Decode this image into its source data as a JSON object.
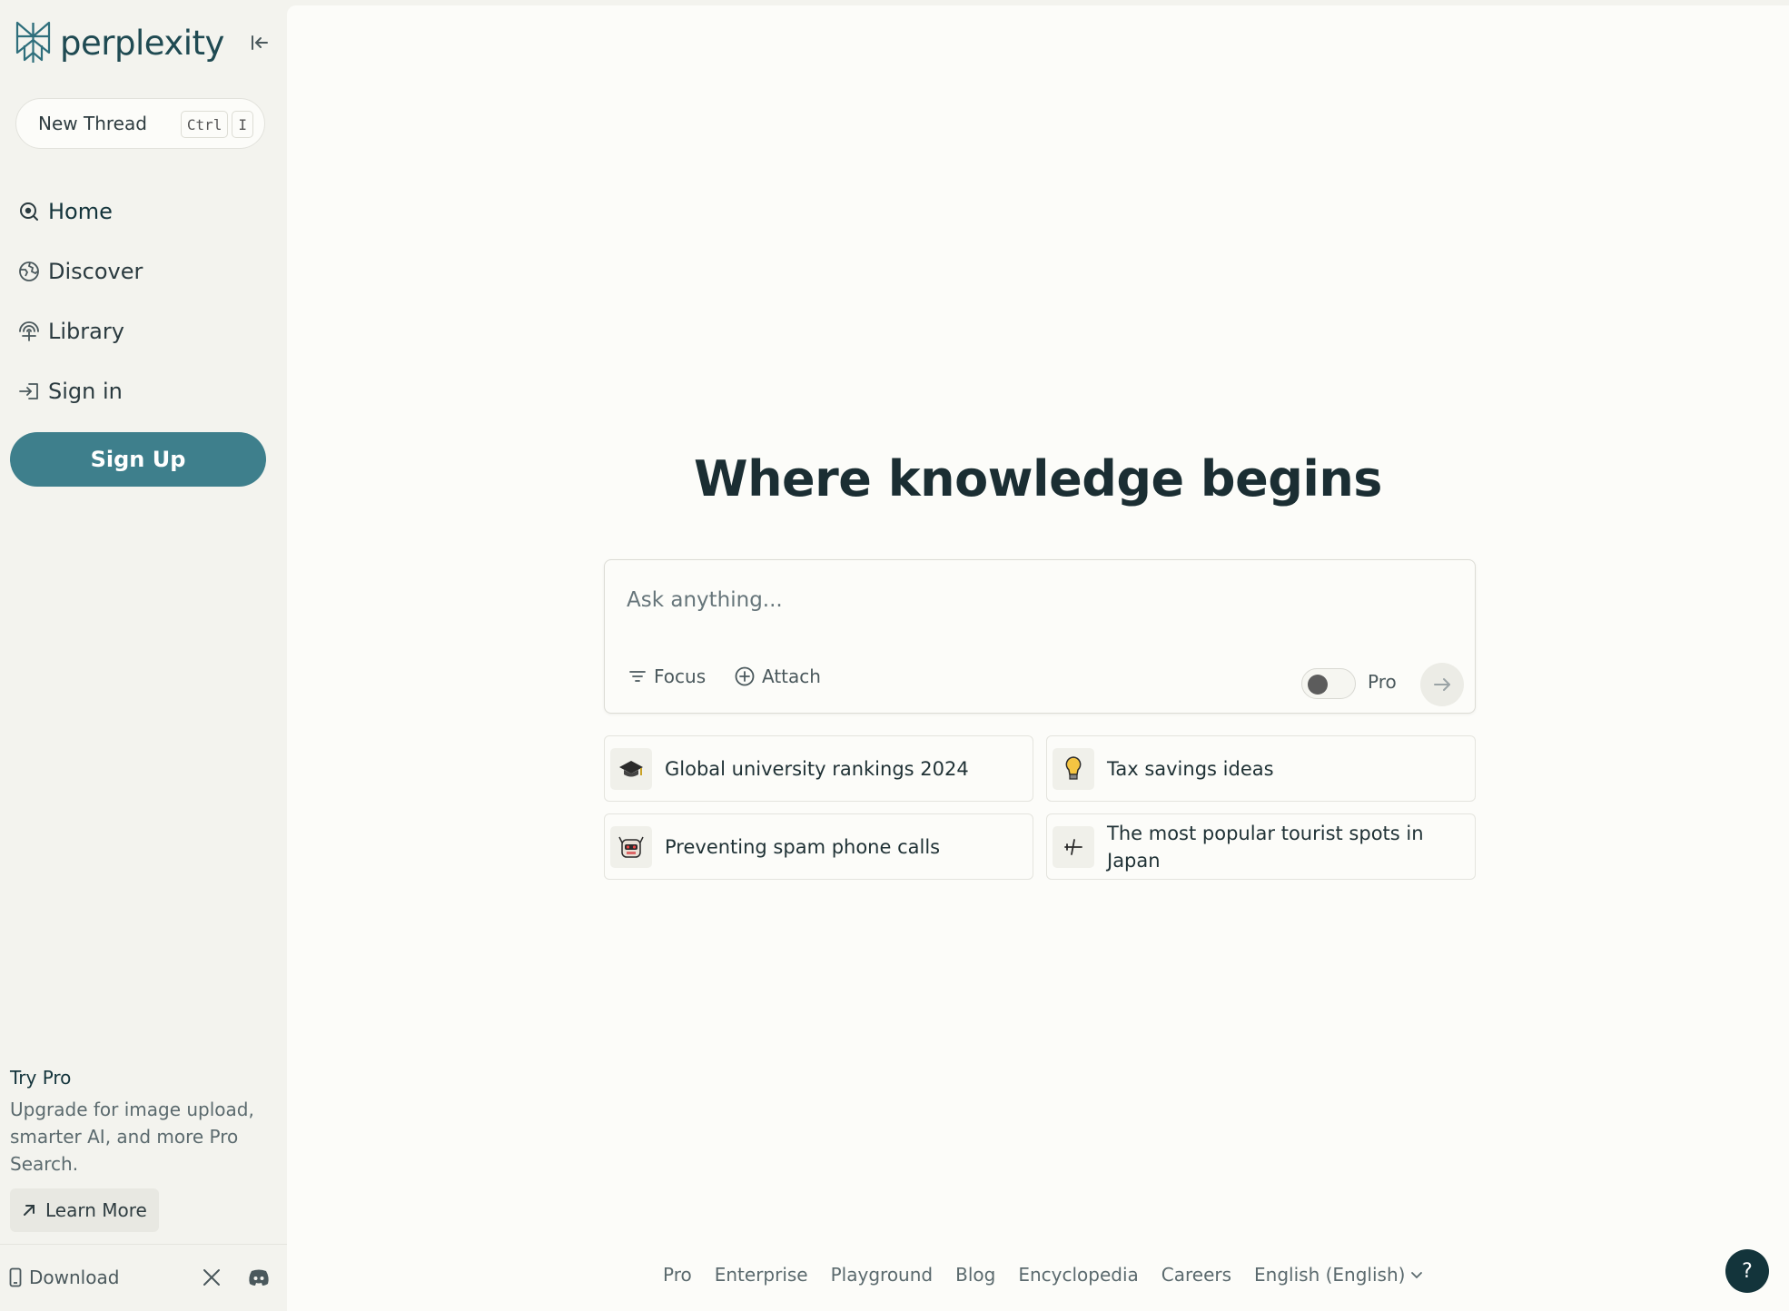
{
  "brand": {
    "name": "perplexity",
    "color": "#1f4a52",
    "accent": "#3e7f8c"
  },
  "sidebar": {
    "new_thread": {
      "label": "New Thread",
      "shortcut_keys": [
        "Ctrl",
        "I"
      ]
    },
    "nav": [
      {
        "label": "Home",
        "icon": "home-search-icon"
      },
      {
        "label": "Discover",
        "icon": "globe-icon"
      },
      {
        "label": "Library",
        "icon": "library-icon"
      },
      {
        "label": "Sign in",
        "icon": "sign-in-icon"
      }
    ],
    "signup_label": "Sign Up",
    "try_pro": {
      "title": "Try Pro",
      "description": "Upgrade for image upload, smarter AI, and more Pro Search.",
      "learn_more": "Learn More"
    },
    "footer": {
      "download": "Download"
    }
  },
  "main": {
    "headline": "Where knowledge begins",
    "search": {
      "placeholder": "Ask anything...",
      "focus_label": "Focus",
      "attach_label": "Attach",
      "pro_label": "Pro",
      "pro_toggle_on": false
    },
    "suggestions": [
      {
        "text": "Global university rankings 2024",
        "icon": "graduation-cap-icon"
      },
      {
        "text": "Tax savings ideas",
        "icon": "lightbulb-icon"
      },
      {
        "text": "Preventing spam phone calls",
        "icon": "robot-face-icon"
      },
      {
        "text": "The most popular tourist spots in Japan",
        "icon": "airplane-icon"
      }
    ],
    "footer_links": [
      "Pro",
      "Enterprise",
      "Playground",
      "Blog",
      "Encyclopedia",
      "Careers"
    ],
    "language": "English (English)",
    "help_label": "?"
  }
}
